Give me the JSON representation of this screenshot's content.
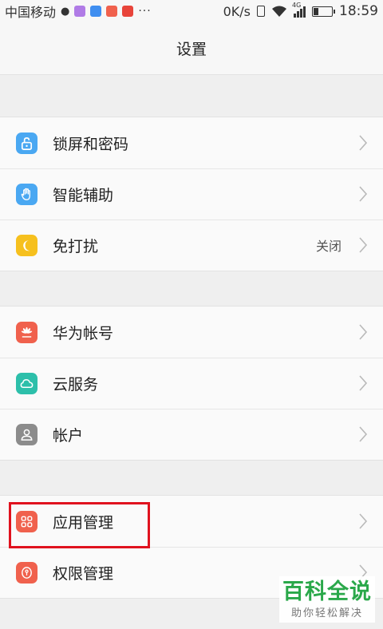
{
  "status_bar": {
    "carrier": "中国移动",
    "dots": "···",
    "speed": "0K/s",
    "network": "4G",
    "time": "18:59"
  },
  "header": {
    "title": "设置"
  },
  "groups": [
    {
      "items": [
        {
          "label": "锁屏和密码",
          "icon": "lock-icon",
          "color": "#4aa8f2"
        },
        {
          "label": "智能辅助",
          "icon": "hand-icon",
          "color": "#4aa8f2"
        },
        {
          "label": "免打扰",
          "icon": "moon-icon",
          "color": "#f6c01e",
          "value": "关闭"
        }
      ]
    },
    {
      "items": [
        {
          "label": "华为帐号",
          "icon": "huawei-icon",
          "color": "#f0614d"
        },
        {
          "label": "云服务",
          "icon": "cloud-icon",
          "color": "#2dbfaa"
        },
        {
          "label": "帐户",
          "icon": "person-icon",
          "color": "#8c8c8c"
        }
      ]
    },
    {
      "items": [
        {
          "label": "应用管理",
          "icon": "apps-grid-icon",
          "color": "#f0614d"
        },
        {
          "label": "权限管理",
          "icon": "shield-key-icon",
          "color": "#f0614d"
        }
      ]
    }
  ],
  "watermark": {
    "main": "百科全说",
    "sub": "助你轻松解决"
  }
}
